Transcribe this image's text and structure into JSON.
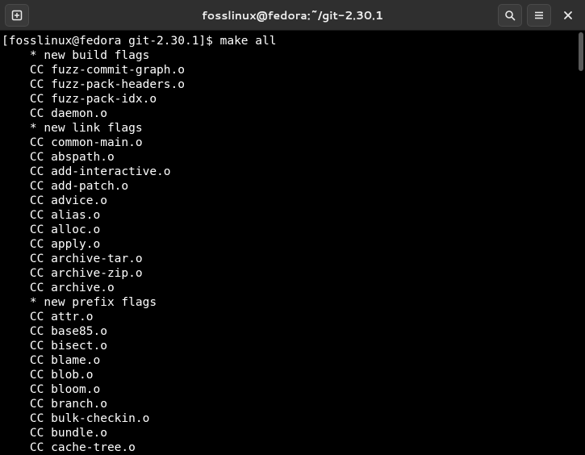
{
  "titlebar": {
    "title": "fosslinux@fedora:~/git-2.30.1"
  },
  "terminal": {
    "prompt": "[fosslinux@fedora git-2.30.1]$ ",
    "command": "make all",
    "lines": [
      "    * new build flags",
      "    CC fuzz-commit-graph.o",
      "    CC fuzz-pack-headers.o",
      "    CC fuzz-pack-idx.o",
      "    CC daemon.o",
      "    * new link flags",
      "    CC common-main.o",
      "    CC abspath.o",
      "    CC add-interactive.o",
      "    CC add-patch.o",
      "    CC advice.o",
      "    CC alias.o",
      "    CC alloc.o",
      "    CC apply.o",
      "    CC archive-tar.o",
      "    CC archive-zip.o",
      "    CC archive.o",
      "    * new prefix flags",
      "    CC attr.o",
      "    CC base85.o",
      "    CC bisect.o",
      "    CC blame.o",
      "    CC blob.o",
      "    CC bloom.o",
      "    CC branch.o",
      "    CC bulk-checkin.o",
      "    CC bundle.o",
      "    CC cache-tree.o"
    ]
  }
}
